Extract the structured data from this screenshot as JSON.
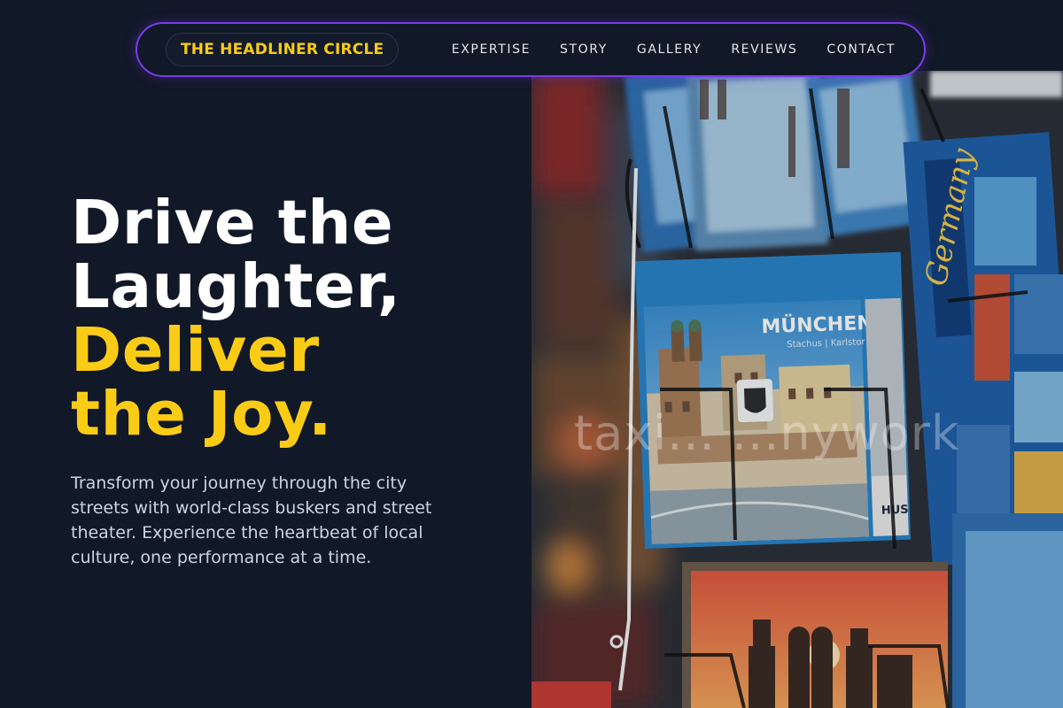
{
  "nav": {
    "brand": "THE HEADLINER CIRCLE",
    "links": [
      "EXPERTISE",
      "STORY",
      "GALLERY",
      "REVIEWS",
      "CONTACT"
    ]
  },
  "hero": {
    "title_line1": "Drive the",
    "title_line2": "Laughter,",
    "title_accent_line1": "Deliver",
    "title_accent_line2": "the Joy.",
    "lead": "Transform your journey through the city streets with world-class buskers and street theater. Experience the heartbeat of local culture, one performance at a time."
  },
  "photo": {
    "postcard_main_title": "MÜNCHEN",
    "postcard_main_sub": "Stachus | Karlstor",
    "postcard_side_label": "HUS",
    "postcard_right_label": "Germany",
    "watermark": "taxi... ...nywork"
  },
  "colors": {
    "background": "#111827",
    "accent": "#facc15",
    "nav_border": "#7c3aed",
    "text_muted": "#cbd5e1"
  }
}
